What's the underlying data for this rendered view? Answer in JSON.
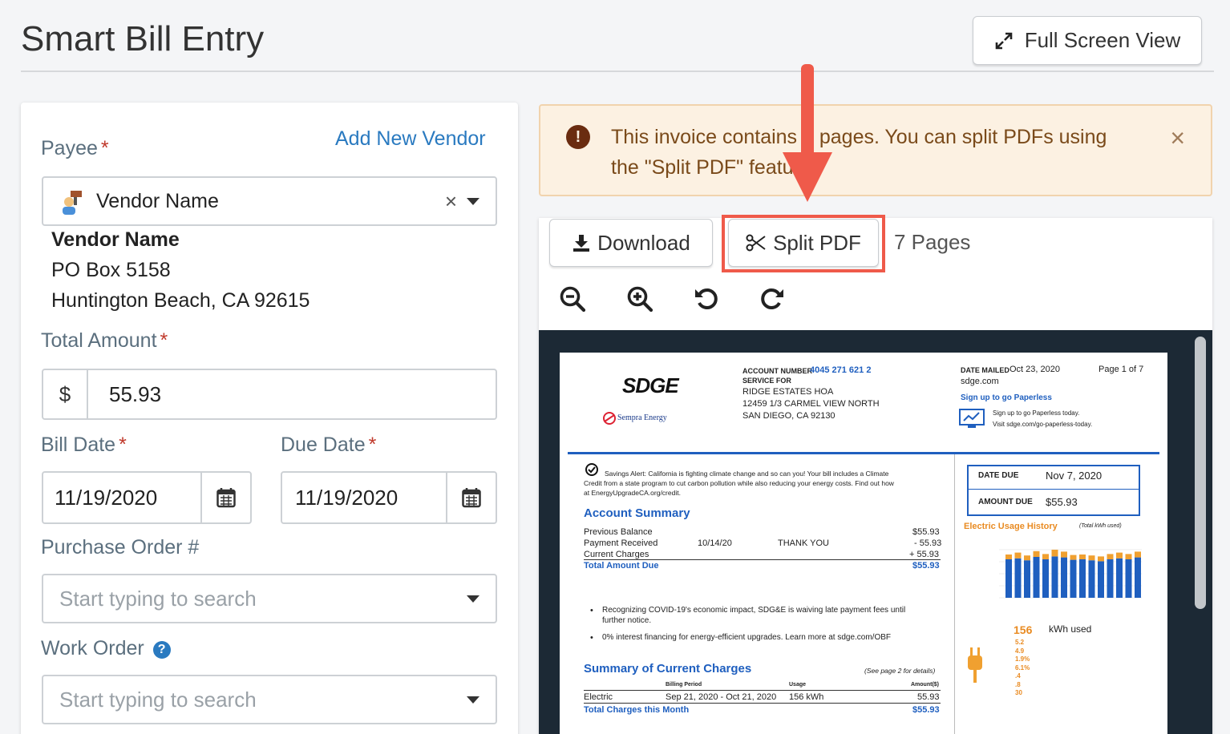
{
  "page_title": "Smart Bill Entry",
  "full_screen_label": "Full Screen View",
  "payee": {
    "label": "Payee",
    "required": "*",
    "add_vendor_link": "Add New Vendor",
    "selected": "Vendor Name",
    "clear": "×",
    "vendor_name": "Vendor Name",
    "address1": "PO Box 5158",
    "address2": "Huntington Beach, CA 92615"
  },
  "total_amount": {
    "label": "Total Amount",
    "required": "*",
    "currency": "$",
    "value": "55.93"
  },
  "bill_date": {
    "label": "Bill Date",
    "required": "*",
    "value": "11/19/2020"
  },
  "due_date": {
    "label": "Due Date",
    "required": "*",
    "value": "11/19/2020"
  },
  "purchase_order": {
    "label": "Purchase Order #",
    "placeholder": "Start typing to search"
  },
  "work_order": {
    "label": "Work Order",
    "help": "?",
    "placeholder": "Start typing to search"
  },
  "alert": {
    "icon": "!",
    "message": "This invoice contains 7 pages. You can split PDFs using the \"Split PDF\" feature.",
    "close": "×"
  },
  "viewer": {
    "download_label": "Download",
    "split_label": "Split PDF",
    "pages_label": "7 Pages"
  },
  "bill": {
    "logo": "SDGE",
    "sempra": "Sempra Energy",
    "acct_label": "ACCOUNT NUMBER",
    "acct_number": "4045 271 621 2",
    "service_for": "SERVICE FOR",
    "svc1": "RIDGE ESTATES HOA",
    "svc2": "12459 1/3 CARMEL VIEW NORTH",
    "svc3": "SAN DIEGO, CA  92130",
    "date_mailed_label": "DATE MAILED",
    "date_mailed": "Oct 23, 2020",
    "page_of": "Page 1 of 7",
    "site": "sdge.com",
    "paperless": "Sign up to go Paperless",
    "paperless_sub1": "Sign up to go Paperless today.",
    "paperless_sub2": "Visit sdge.com/go-paperless-today.",
    "alert_line1": "Savings Alert: California is fighting climate change and so can you! Your bill includes a Climate",
    "alert_line2": "Credit from a state program to cut carbon pollution while also reducing your energy costs. Find out how",
    "alert_line3": "at EnergyUpgradeCA.org/credit.",
    "summary_title": "Account Summary",
    "prev_balance": "Previous Balance",
    "prev_value": "$55.93",
    "payment": "Payment Received",
    "payment_date": "10/14/20",
    "payment_note": "THANK YOU",
    "payment_value": "- 55.93",
    "current": "Current Charges",
    "current_value": "+ 55.93",
    "total_due": "Total Amount Due",
    "total_value": "$55.93",
    "bullet1a": "Recognizing COVID-19's economic impact, SDG&E is waiving late payment fees until",
    "bullet1b": "further notice.",
    "bullet2": "0% interest financing for energy-efficient upgrades. Learn more at sdge.com/OBF",
    "charges_title": "Summary of Current Charges",
    "see_page": "(See page 2 for details)",
    "billing_period_h": "Billing Period",
    "usage_h": "Usage",
    "amount_h": "Amount($)",
    "electric": "Electric",
    "period": "Sep 21, 2020 - Oct 21, 2020",
    "usage": "156 kWh",
    "electric_amt": "55.93",
    "total_charges": "Total Charges this Month",
    "total_charges_amt": "$55.93",
    "date_due_label": "DATE DUE",
    "date_due": "Nov 7, 2020",
    "amount_due_label": "AMOUNT DUE",
    "amount_due": "$55.93",
    "usage_history": "Electric Usage History",
    "usage_history_sub": "(Total kWh used)",
    "kwh_value": "156",
    "kwh_label": "kWh used",
    "stats": [
      "5.2",
      "4.9",
      "1.9%",
      "6.1%",
      ".4",
      ".8",
      "30"
    ],
    "chart_bars": [
      0.8,
      0.82,
      0.78,
      0.85,
      0.8,
      0.86,
      0.84,
      0.79,
      0.8,
      0.78,
      0.76,
      0.8,
      0.82,
      0.8,
      0.84
    ],
    "chart_peaks": [
      0.1,
      0.12,
      0.1,
      0.12,
      0.11,
      0.14,
      0.12,
      0.1,
      0.1,
      0.1,
      0.1,
      0.11,
      0.12,
      0.11,
      0.12
    ]
  },
  "colors": {
    "accent": "#2a7ac0",
    "highlight": "#ef5a4a",
    "alert_bg": "#fcf1e2"
  }
}
